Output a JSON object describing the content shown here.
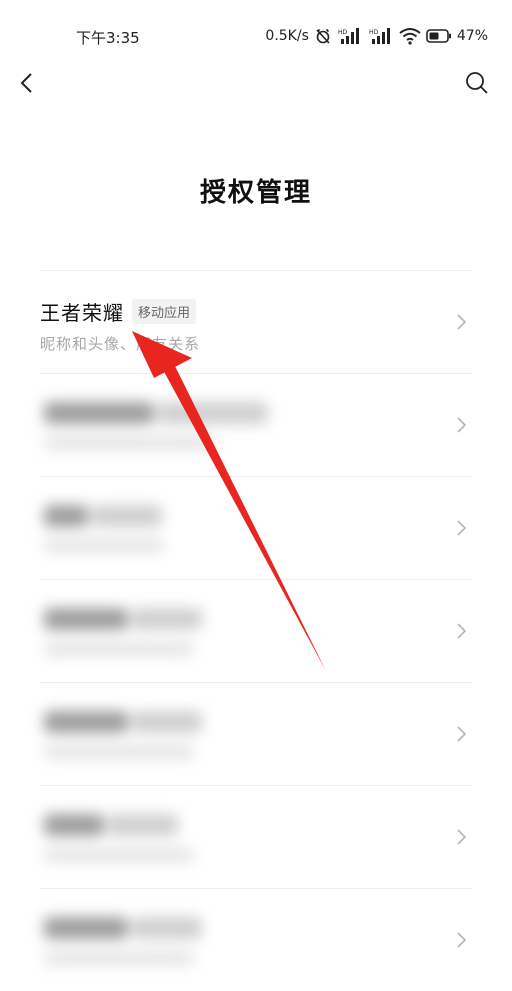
{
  "status_bar": {
    "time": "下午3:35",
    "network_speed": "0.5K/s",
    "battery": "47%",
    "icons": [
      "alarm-off-icon",
      "hd-signal-icon",
      "hd-signal-icon",
      "wifi-icon",
      "battery-icon"
    ]
  },
  "nav": {
    "back_icon": "chevron-left-icon",
    "search_icon": "search-icon"
  },
  "page_title": "授权管理",
  "list": {
    "items": [
      {
        "name": "王者荣耀",
        "tag": "移动应用",
        "subtitle": "昵称和头像、朋友关系",
        "blurred": false
      },
      {
        "blurred": true
      },
      {
        "blurred": true
      },
      {
        "blurred": true
      },
      {
        "blurred": true
      },
      {
        "blurred": true
      },
      {
        "blurred": true
      }
    ]
  },
  "annotation": {
    "type": "red-arrow",
    "color": "#e8251f"
  }
}
